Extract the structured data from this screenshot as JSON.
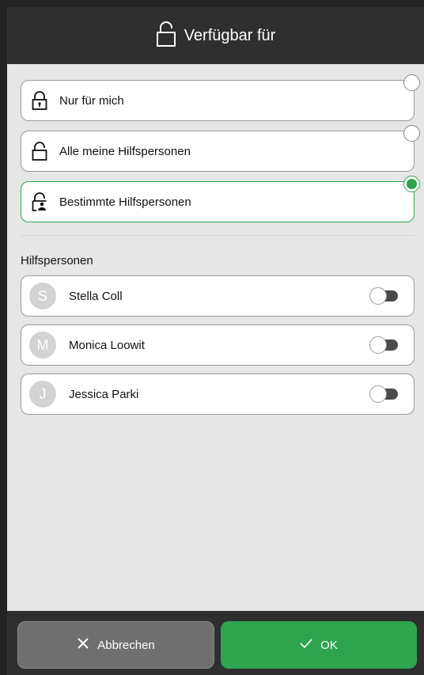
{
  "header": {
    "title": "Verfügbar für",
    "icon": "unlock-icon"
  },
  "options": [
    {
      "label": "Nur für mich",
      "icon": "lock-icon",
      "selected": false
    },
    {
      "label": "Alle meine Hilfspersonen",
      "icon": "unlock-icon",
      "selected": false
    },
    {
      "label": "Bestimmte Hilfspersonen",
      "icon": "unlock-person-icon",
      "selected": true
    }
  ],
  "helpers_section": {
    "label": "Hilfspersonen",
    "items": [
      {
        "initial": "S",
        "name": "Stella Coll",
        "enabled": false
      },
      {
        "initial": "M",
        "name": "Monica Loowit",
        "enabled": false
      },
      {
        "initial": "J",
        "name": "Jessica Parki",
        "enabled": false
      }
    ]
  },
  "footer": {
    "cancel_label": "Abbrechen",
    "ok_label": "OK"
  },
  "colors": {
    "accent": "#2ea44f",
    "header_bg": "#2f2f2f",
    "body_bg": "#e6e6e6"
  }
}
